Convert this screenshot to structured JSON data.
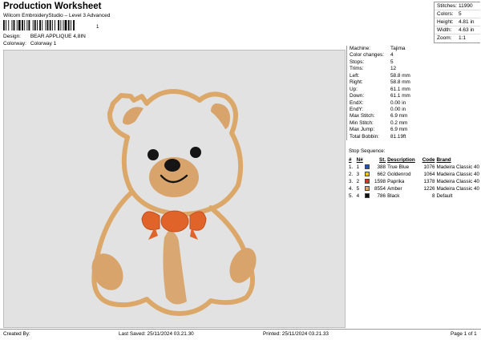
{
  "header": {
    "title": "Production Worksheet",
    "subtitle": "Wilcom EmbroideryStudio – Level 3 Advanced",
    "barcode_number": "1"
  },
  "design_meta": [
    {
      "label": "Design:",
      "value": "BEAR APPLIQUE 4,8IN"
    },
    {
      "label": "Colorway:",
      "value": "Colorway 1"
    }
  ],
  "summary": [
    {
      "label": "Stitches:",
      "value": "11990"
    },
    {
      "label": "Colors:",
      "value": "5"
    },
    {
      "label": "Height:",
      "value": "4.81 in"
    },
    {
      "label": "Width:",
      "value": "4.63 in"
    },
    {
      "label": "Zoom:",
      "value": "1:1"
    }
  ],
  "machine_info": [
    {
      "label": "Machine:",
      "value": "Tajima"
    },
    {
      "label": "Color changes:",
      "value": "4"
    },
    {
      "label": "Stops:",
      "value": "5"
    },
    {
      "label": "Trims:",
      "value": "12"
    },
    {
      "label": "Left:",
      "value": "58.8 mm"
    },
    {
      "label": "Right:",
      "value": "58.8 mm"
    },
    {
      "label": "Up:",
      "value": "61.1 mm"
    },
    {
      "label": "Down:",
      "value": "61.1 mm"
    },
    {
      "label": "EndX:",
      "value": "0.00 in"
    },
    {
      "label": "EndY:",
      "value": "0.00 in"
    },
    {
      "label": "Max Stitch:",
      "value": "6.9 mm"
    },
    {
      "label": "Min Stitch:",
      "value": "0.2 mm"
    },
    {
      "label": "Max Jump:",
      "value": "6.9 mm"
    },
    {
      "label": "Total Bobbin:",
      "value": "81.19ft"
    }
  ],
  "stop_sequence": {
    "title": "Stop Sequence:",
    "headers": [
      "#",
      "N#",
      "St.",
      "Description",
      "Code",
      "Brand"
    ],
    "rows": [
      {
        "index": "1.",
        "needle": "1",
        "color": "#1e56b4",
        "stitches": "388",
        "description": "True Blue",
        "code": "1076",
        "brand": "Madeira Classic 40"
      },
      {
        "index": "2.",
        "needle": "3",
        "color": "#f2c21b",
        "stitches": "662",
        "description": "Goldenrod",
        "code": "1064",
        "brand": "Madeira Classic 40"
      },
      {
        "index": "3.",
        "needle": "2",
        "color": "#d3362a",
        "stitches": "1598",
        "description": "Paprika",
        "code": "1378",
        "brand": "Madeira Classic 40"
      },
      {
        "index": "4.",
        "needle": "5",
        "color": "#e1a266",
        "stitches": "8554",
        "description": "Amber",
        "code": "1226",
        "brand": "Madeira Classic 40"
      },
      {
        "index": "5.",
        "needle": "4",
        "color": "#111111",
        "stitches": "786",
        "description": "Black",
        "code": "8",
        "brand": "Default"
      }
    ]
  },
  "footer": {
    "created_by": "Created By:",
    "last_saved": "Last Saved: 25/11/2024 03.21.30",
    "printed": "Printed: 25/11/2024 03.21.33",
    "page": "Page 1 of 1"
  },
  "colors": {
    "preview_bg": "#e2e2e2",
    "outline": "#dca86a",
    "fill": "#d8a46c",
    "bow": "#e0642a"
  }
}
